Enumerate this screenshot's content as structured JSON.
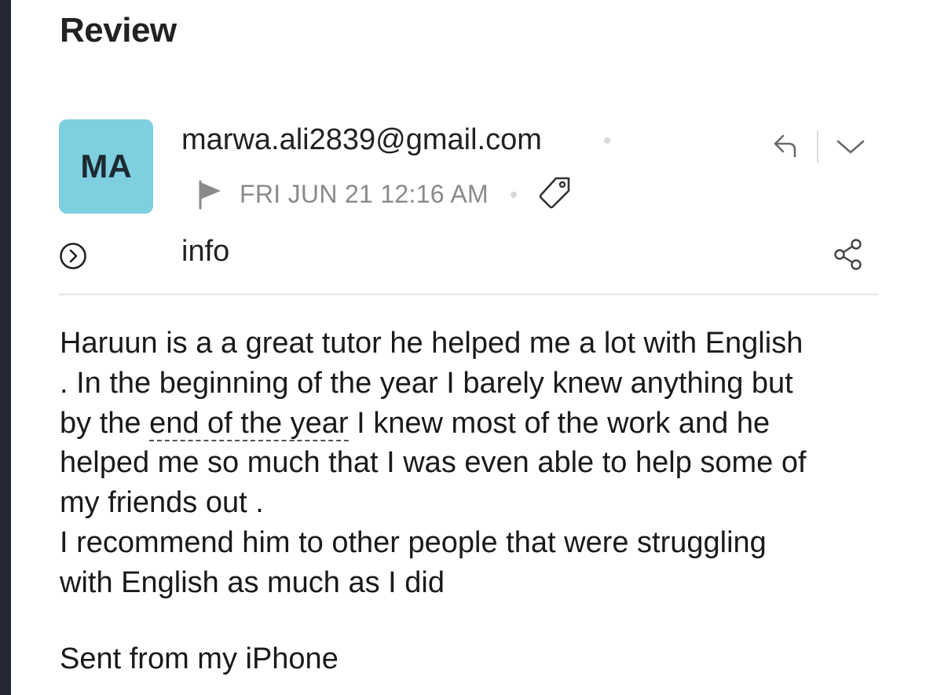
{
  "header": {
    "title": "Review"
  },
  "message": {
    "avatar_initials": "MA",
    "avatar_color": "#7ecfe0",
    "sender": "marwa.ali2839@gmail.com",
    "date": "FRI JUN 21 12:16 AM",
    "recipient": "info",
    "body": {
      "line1": "Haruun is a a great tutor he helped me a lot with English",
      "line2": ". In the beginning of the year I barely knew anything but",
      "line3_pre": "by the ",
      "line3_link": "end of the year",
      "line3_post": " I knew most of the work and he",
      "line4": "helped me so much that I was even able to help some of",
      "line5": "my friends out .",
      "line6": "I recommend him to other people that were struggling",
      "line7": "with English as much as I did"
    },
    "signature": "Sent from my iPhone"
  },
  "icons": {
    "reply": "reply-icon",
    "more": "chevron-down-icon",
    "flag": "flag-icon",
    "tag": "tag-icon",
    "expand": "expand-details-icon",
    "share": "share-icon"
  }
}
